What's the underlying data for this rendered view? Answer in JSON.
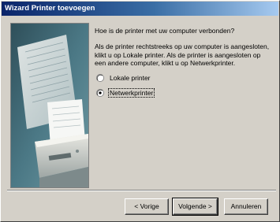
{
  "window": {
    "title": "Wizard Printer toevoegen"
  },
  "content": {
    "question": "Hoe is de printer met uw computer verbonden?",
    "info_lines": [
      "Als de printer rechtstreeks op uw computer is aangesloten,",
      "klikt u op Lokale printer. Als de printer is aangesloten op",
      "een andere computer, klikt u op Netwerkprinter."
    ]
  },
  "options": [
    {
      "label": "Lokale printer",
      "selected": false
    },
    {
      "label": "Netwerkprinter",
      "selected": true
    }
  ],
  "buttons": {
    "back": "< Vorige",
    "next": "Volgende >",
    "cancel": "Annuleren"
  },
  "colors": {
    "title_start": "#0a246a",
    "title_end": "#a6caf0",
    "face": "#d4d0c8"
  }
}
